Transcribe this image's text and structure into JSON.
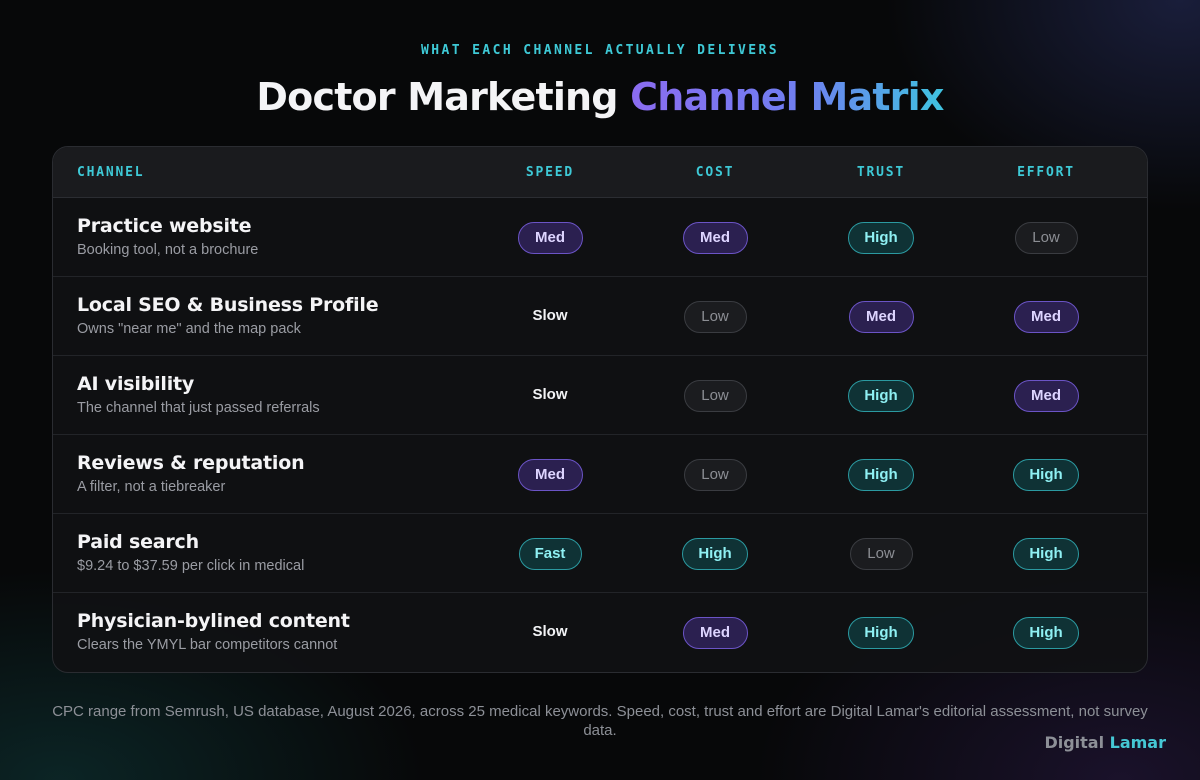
{
  "header": {
    "eyebrow": "WHAT EACH CHANNEL ACTUALLY DELIVERS",
    "title_main": "Doctor Marketing ",
    "title_accent": "Channel Matrix"
  },
  "table": {
    "columns": [
      "CHANNEL",
      "SPEED",
      "COST",
      "TRUST",
      "EFFORT"
    ],
    "rows": [
      {
        "name": "Practice website",
        "subtitle": "Booking tool, not a brochure",
        "ratings": [
          "Med",
          "Med",
          "High",
          "Low"
        ]
      },
      {
        "name": "Local SEO & Business Profile",
        "subtitle": "Owns \"near me\" and the map pack",
        "ratings": [
          "Slow",
          "Low",
          "Med",
          "Med"
        ]
      },
      {
        "name": "AI visibility",
        "subtitle": "The channel that just passed referrals",
        "ratings": [
          "Slow",
          "Low",
          "High",
          "Med"
        ]
      },
      {
        "name": "Reviews & reputation",
        "subtitle": "A filter, not a tiebreaker",
        "ratings": [
          "Med",
          "Low",
          "High",
          "High"
        ]
      },
      {
        "name": "Paid search",
        "subtitle": "$9.24 to $37.59 per click in medical",
        "ratings": [
          "Fast",
          "High",
          "Low",
          "High"
        ]
      },
      {
        "name": "Physician-bylined content",
        "subtitle": "Clears the YMYL bar competitors cannot",
        "ratings": [
          "Slow",
          "Med",
          "High",
          "High"
        ]
      }
    ]
  },
  "footnote": "CPC range from Semrush, US database, August 2026, across 25 medical keywords. Speed, cost, trust and effort are Digital Lamar's editorial assessment, not survey data.",
  "brand": {
    "part1": "Digital ",
    "part2": "Lamar"
  },
  "colors": {
    "accent_cyan": "#3ec9d6",
    "accent_purple": "#8b6cf0",
    "pill_med": "#6b54c6",
    "pill_high": "#2b9aa1",
    "pill_low": "#3a3c41",
    "background": "#070809"
  }
}
